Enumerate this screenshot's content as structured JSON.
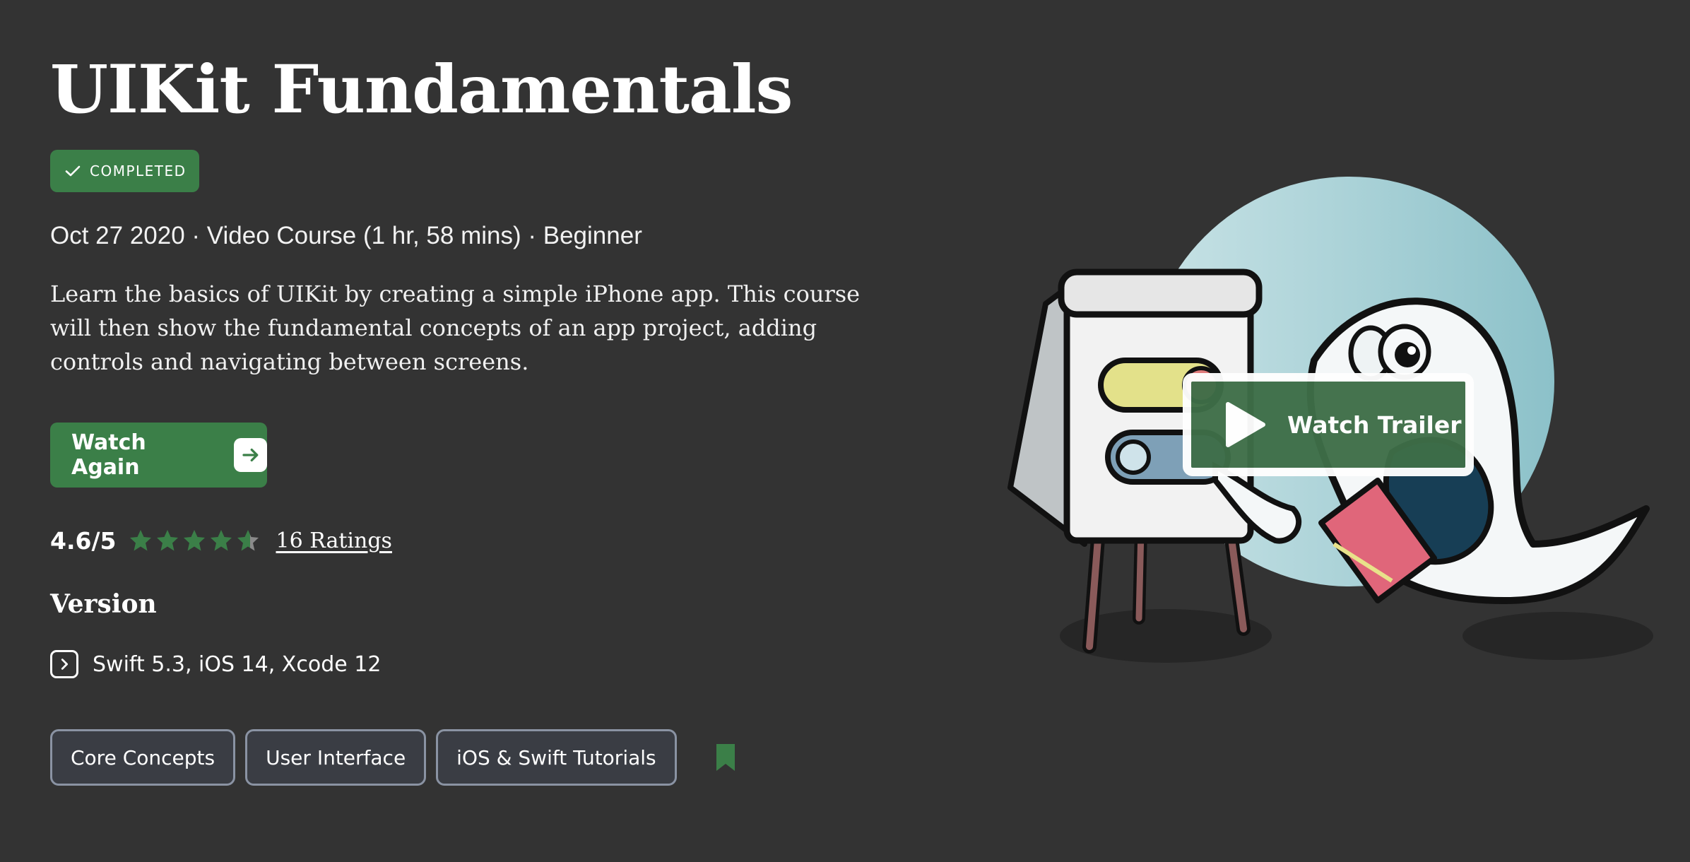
{
  "course": {
    "title": "UIKit Fundamentals",
    "status_badge": "COMPLETED",
    "meta": "Oct 27 2020 · Video Course (1 hr, 58 mins) · Beginner",
    "description": "Learn the basics of UIKit by creating a simple iPhone app. This course will then show the fundamental concepts of an app project, adding controls and navigating between screens."
  },
  "actions": {
    "watch_again_label": "Watch Again",
    "watch_trailer_label": "Watch Trailer"
  },
  "rating": {
    "score_text": "4.6/5",
    "score": 4.6,
    "max": 5,
    "count_label": "16 Ratings"
  },
  "version": {
    "heading": "Version",
    "value": "Swift 5.3, iOS 14, Xcode 12"
  },
  "tags": [
    "Core Concepts",
    "User Interface",
    "iOS & Swift Tutorials"
  ],
  "colors": {
    "background": "#333333",
    "accent_green": "#3b7f48",
    "star_filled": "#3b7f48",
    "star_empty": "#8a8a8a",
    "tag_border": "#8a93a3"
  },
  "icons": {
    "badge": "check-icon",
    "watch_again": "arrow-right-icon",
    "version": "chevron-right-icon",
    "trailer": "play-icon",
    "bookmark": "bookmark-icon"
  }
}
